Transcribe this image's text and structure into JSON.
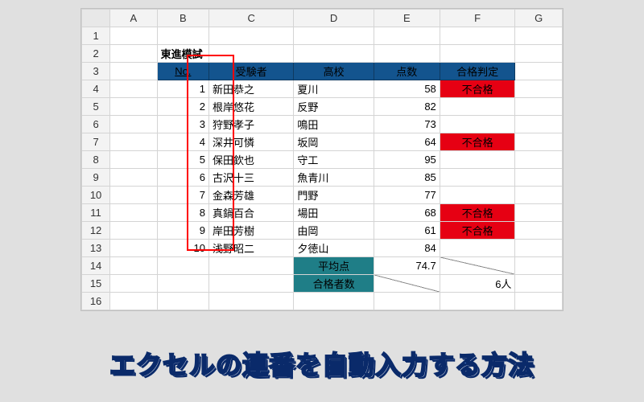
{
  "columns": [
    "",
    "A",
    "B",
    "C",
    "D",
    "E",
    "F",
    "G"
  ],
  "title": "東進模試",
  "headers": {
    "no": "No.",
    "name": "受験者",
    "school": "高校",
    "score": "点数",
    "result": "合格判定"
  },
  "rows": [
    {
      "no": 1,
      "name": "新田恭之",
      "school": "夏川",
      "score": 58,
      "result": "不合格"
    },
    {
      "no": 2,
      "name": "根岸悠花",
      "school": "反野",
      "score": 82,
      "result": ""
    },
    {
      "no": 3,
      "name": "狩野孝子",
      "school": "鳴田",
      "score": 73,
      "result": ""
    },
    {
      "no": 4,
      "name": "深井可憐",
      "school": "坂岡",
      "score": 64,
      "result": "不合格"
    },
    {
      "no": 5,
      "name": "保田欽也",
      "school": "守工",
      "score": 95,
      "result": ""
    },
    {
      "no": 6,
      "name": "古沢十三",
      "school": "魚青川",
      "score": 85,
      "result": ""
    },
    {
      "no": 7,
      "name": "金森芳雄",
      "school": "門野",
      "score": 77,
      "result": ""
    },
    {
      "no": 8,
      "name": "真鍋百合",
      "school": "場田",
      "score": 68,
      "result": "不合格"
    },
    {
      "no": 9,
      "name": "岸田芳樹",
      "school": "由岡",
      "score": 61,
      "result": "不合格"
    },
    {
      "no": 10,
      "name": "浅野昭二",
      "school": "夕徳山",
      "score": 84,
      "result": ""
    }
  ],
  "summary": {
    "avg_label": "平均点",
    "avg_value": "74.7",
    "passcount_label": "合格者数",
    "passcount_value": "6人"
  },
  "caption": "エクセルの連番を自動入力する方法",
  "chart_data": {
    "type": "table",
    "title": "東進模試",
    "columns": [
      "No.",
      "受験者",
      "高校",
      "点数",
      "合格判定"
    ],
    "data": [
      [
        1,
        "新田恭之",
        "夏川",
        58,
        "不合格"
      ],
      [
        2,
        "根岸悠花",
        "反野",
        82,
        ""
      ],
      [
        3,
        "狩野孝子",
        "鳴田",
        73,
        ""
      ],
      [
        4,
        "深井可憐",
        "坂岡",
        64,
        "不合格"
      ],
      [
        5,
        "保田欽也",
        "守工",
        95,
        ""
      ],
      [
        6,
        "古沢十三",
        "魚青川",
        85,
        ""
      ],
      [
        7,
        "金森芳雄",
        "門野",
        77,
        ""
      ],
      [
        8,
        "真鍋百合",
        "場田",
        68,
        "不合格"
      ],
      [
        9,
        "岸田芳樹",
        "由岡",
        61,
        "不合格"
      ],
      [
        10,
        "浅野昭二",
        "夕徳山",
        84,
        ""
      ]
    ],
    "summary": {
      "平均点": 74.7,
      "合格者数": "6人"
    }
  }
}
